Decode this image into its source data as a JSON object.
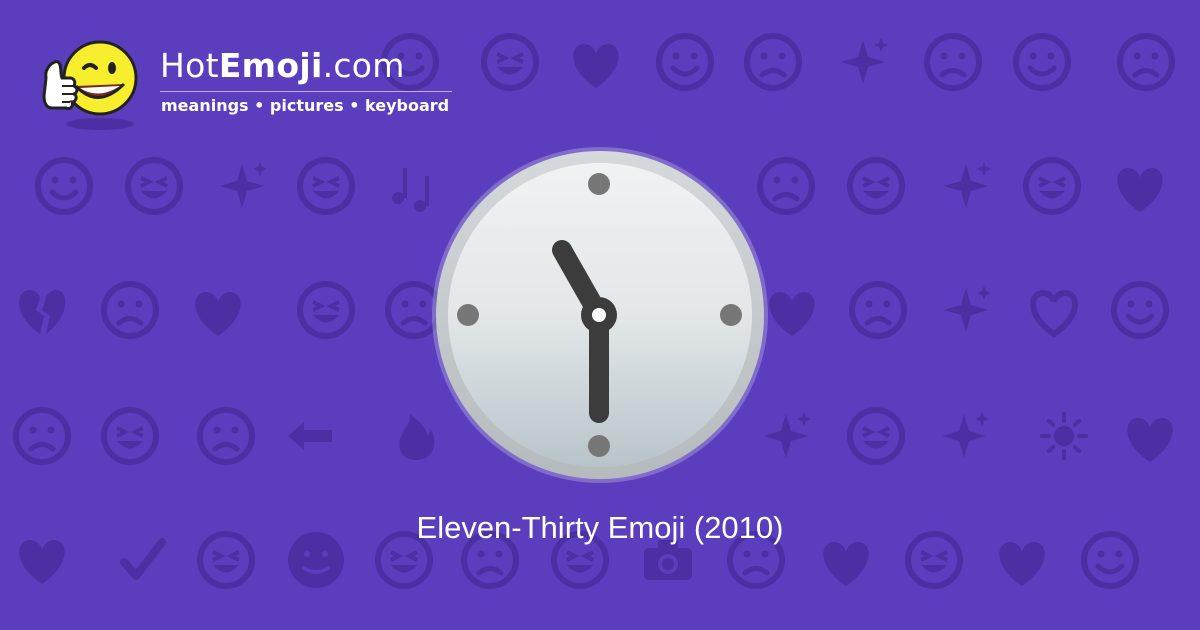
{
  "brand": {
    "name_prefix": "Hot",
    "name_bold": "Emoji",
    "name_suffix": ".com",
    "tagline": "meanings • pictures • keyboard",
    "mascot_icon": "thumbs-up-wink-face-icon"
  },
  "hero": {
    "emoji_icon": "clock-eleven-thirty-icon",
    "caption": "Eleven-Thirty Emoji (2010)"
  },
  "colors": {
    "background": "#5b3ebd",
    "pattern": "#4a30a3",
    "text": "#ffffff",
    "clock_hands": "#3c3c3c",
    "clock_markers": "#777777"
  }
}
